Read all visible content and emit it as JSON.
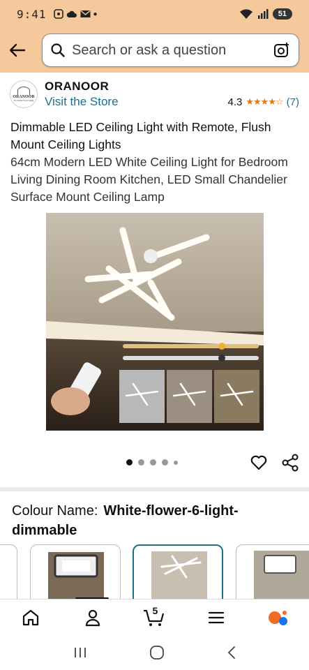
{
  "status_bar": {
    "time": "9:41",
    "battery": "51"
  },
  "search": {
    "placeholder": "Search or ask a question"
  },
  "store": {
    "logo_text": "ORANOOR",
    "logo_tagline": "Yo Same Your Light",
    "name": "ORANOOR",
    "visit_link": "Visit the Store",
    "rating": "4.3",
    "stars": "★★★★☆",
    "review_count": "(7)"
  },
  "product": {
    "title_main": "Dimmable LED Ceiling Light with Remote, Flush Mount Ceiling Lights",
    "title_detail": "64cm Modern LED White Ceiling Light for Bedroom Living Dining Room Kitchen, LED Small Chandelier Surface Mount Ceiling Lamp",
    "image_count": 5,
    "active_image_index": 0
  },
  "variant": {
    "label": "Colour Name:",
    "value": "White-flower-6-light-dimmable"
  },
  "bottom_nav": {
    "items": [
      {
        "name": "home",
        "icon": "home-icon"
      },
      {
        "name": "account",
        "icon": "person-icon"
      },
      {
        "name": "cart",
        "icon": "cart-icon"
      },
      {
        "name": "menu",
        "icon": "menu-icon"
      },
      {
        "name": "rufus",
        "icon": "chat-assistant-icon"
      }
    ],
    "cart_count": "5"
  },
  "colors": {
    "header_bg": "#f6c99c",
    "link": "#1f6f87",
    "star": "#e47911",
    "selected_border": "#1f6f87"
  }
}
